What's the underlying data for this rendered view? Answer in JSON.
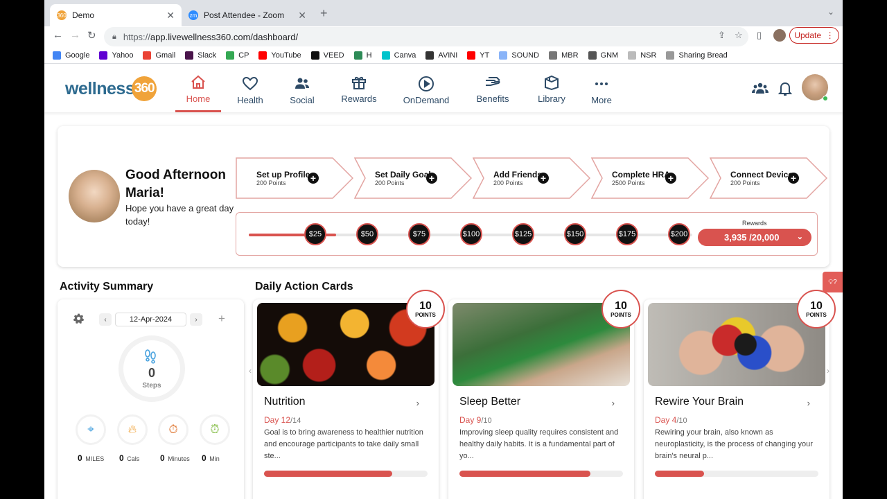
{
  "browser": {
    "tabs": [
      {
        "title": "Demo",
        "favicon": "wellness-favicon"
      },
      {
        "title": "Post Attendee - Zoom",
        "favicon": "zoom-favicon"
      }
    ],
    "url_proto": "https://",
    "url_rest": "app.livewellness360.com/dashboard/",
    "update_label": "Update",
    "bookmarks": [
      {
        "label": "Google",
        "color": "#4285f4"
      },
      {
        "label": "Yahoo",
        "color": "#6001d2"
      },
      {
        "label": "Gmail",
        "color": "#ea4335"
      },
      {
        "label": "Slack",
        "color": "#4a154b"
      },
      {
        "label": "CP",
        "color": "#34a853"
      },
      {
        "label": "YouTube",
        "color": "#ff0000"
      },
      {
        "label": "VEED",
        "color": "#111111"
      },
      {
        "label": "H",
        "color": "#2e8b57"
      },
      {
        "label": "Canva",
        "color": "#00c4cc"
      },
      {
        "label": "AVINI",
        "color": "#333333"
      },
      {
        "label": "YT",
        "color": "#ff0000"
      },
      {
        "label": "SOUND",
        "color": "#8ab4f8"
      },
      {
        "label": "MBR",
        "color": "#777777"
      },
      {
        "label": "GNM",
        "color": "#555555"
      },
      {
        "label": "NSR",
        "color": "#bbbbbb"
      },
      {
        "label": "Sharing Bread",
        "color": "#999999"
      }
    ]
  },
  "app": {
    "logo_text": "wellness",
    "logo_num": "360",
    "nav": [
      {
        "label": "Home",
        "icon": "home-icon"
      },
      {
        "label": "Health",
        "icon": "heart-icon"
      },
      {
        "label": "Social",
        "icon": "people-icon"
      },
      {
        "label": "Rewards",
        "icon": "gift-icon"
      },
      {
        "label": "OnDemand",
        "icon": "play-icon"
      },
      {
        "label": "Benefits",
        "icon": "benefits-icon"
      },
      {
        "label": "Library",
        "icon": "library-icon"
      },
      {
        "label": "More",
        "icon": "more-icon"
      }
    ]
  },
  "welcome": {
    "greeting": "Good Afternoon Maria!",
    "subtext": "Hope you have a great day today!",
    "steps": [
      {
        "title": "Set up Profile",
        "points": "200 Points"
      },
      {
        "title": "Set Daily Goal",
        "points": "200 Points"
      },
      {
        "title": "Add Friends",
        "points": "200 Points"
      },
      {
        "title": "Complete HRA",
        "points": "2500 Points"
      },
      {
        "title": "Connect Device",
        "points": "200 Points"
      }
    ],
    "milestones": [
      "$25",
      "$50",
      "$75",
      "$100",
      "$125",
      "$150",
      "$175",
      "$200"
    ],
    "progress_fraction": 0.197,
    "rewards_label": "Rewards",
    "rewards_value": "3,935 /20,000"
  },
  "activity": {
    "title": "Activity Summary",
    "date": "12-Apr-2024",
    "steps_value": "0",
    "steps_label": "Steps",
    "metrics": [
      {
        "value": "0",
        "unit": "MILES",
        "icon": "location-icon",
        "color": "#4aa3df"
      },
      {
        "value": "0",
        "unit": "Cals",
        "icon": "flame-icon",
        "color": "#f0a33a"
      },
      {
        "value": "0",
        "unit": "Minutes",
        "icon": "stopwatch-icon",
        "color": "#e07b39"
      },
      {
        "value": "0",
        "unit": "Min",
        "icon": "active-min-icon",
        "color": "#8cc152"
      }
    ]
  },
  "daily": {
    "title": "Daily Action Cards",
    "cards": [
      {
        "title": "Nutrition",
        "points": "10",
        "points_label": "POINTS",
        "day": "Day 12",
        "of": "/14",
        "desc": "Goal is to bring awareness to healthier nutrition and encourage participants to take daily small ste...",
        "progress": 0.786
      },
      {
        "title": "Sleep Better",
        "points": "10",
        "points_label": "POINTS",
        "day": "Day 9",
        "of": "/10",
        "desc": "Improving sleep quality requires consistent and healthy daily habits. It is a fundamental part of yo...",
        "progress": 0.8
      },
      {
        "title": "Rewire Your Brain",
        "points": "10",
        "points_label": "POINTS",
        "day": "Day 4",
        "of": "/10",
        "desc": "Rewiring your brain, also known as neuroplasticity, is the process of changing your brain's neural p...",
        "progress": 0.3
      }
    ]
  }
}
